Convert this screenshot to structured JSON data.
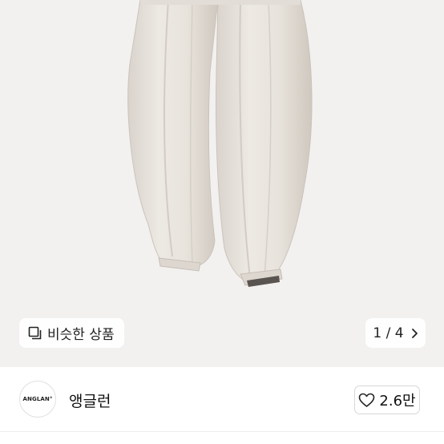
{
  "image": {
    "description_icon": "product-photo",
    "background": "#f2f1f0",
    "garment_color": "#e6e1db"
  },
  "similar_button": {
    "label": "비슷한 상품",
    "icon": "similar-items-icon"
  },
  "pager": {
    "text": "1 / 4",
    "icon": "chevron-right-icon"
  },
  "seller": {
    "logo_text": "ANGLAN°",
    "name": "앵글런"
  },
  "like": {
    "count": "2.6만",
    "icon": "heart-outline-icon"
  }
}
